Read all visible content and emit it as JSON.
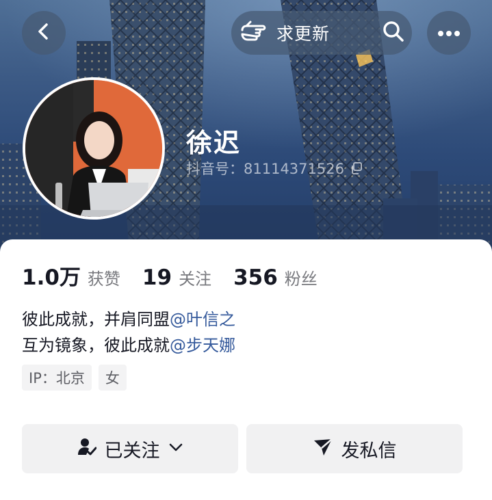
{
  "header": {
    "back_icon": "chevron-left-icon",
    "update_label": "求更新",
    "update_icon": "pointing-hand-icon",
    "search_icon": "search-icon",
    "more_icon": "more-dots-icon"
  },
  "profile": {
    "name": "徐迟",
    "douyin_id": "抖音号：81114371526",
    "copy_icon": "copy-icon"
  },
  "stats": [
    {
      "value": "1.0万",
      "label": "获赞"
    },
    {
      "value": "19",
      "label": "关注"
    },
    {
      "value": "356",
      "label": "粉丝"
    }
  ],
  "bio": {
    "line1_text": "彼此成就，并肩同盟",
    "line1_mention": "@叶信之",
    "line2_text": "互为镜象，彼此成就",
    "line2_mention": "@步天娜"
  },
  "tags": [
    "IP：北京",
    "女"
  ],
  "actions": {
    "follow_label": "已关注",
    "follow_icon": "user-check-icon",
    "message_label": "发私信",
    "message_icon": "send-icon"
  },
  "colors": {
    "mention": "#34599b",
    "text": "#161823",
    "muted": "#78797e",
    "button_bg": "#f1f1f2"
  }
}
